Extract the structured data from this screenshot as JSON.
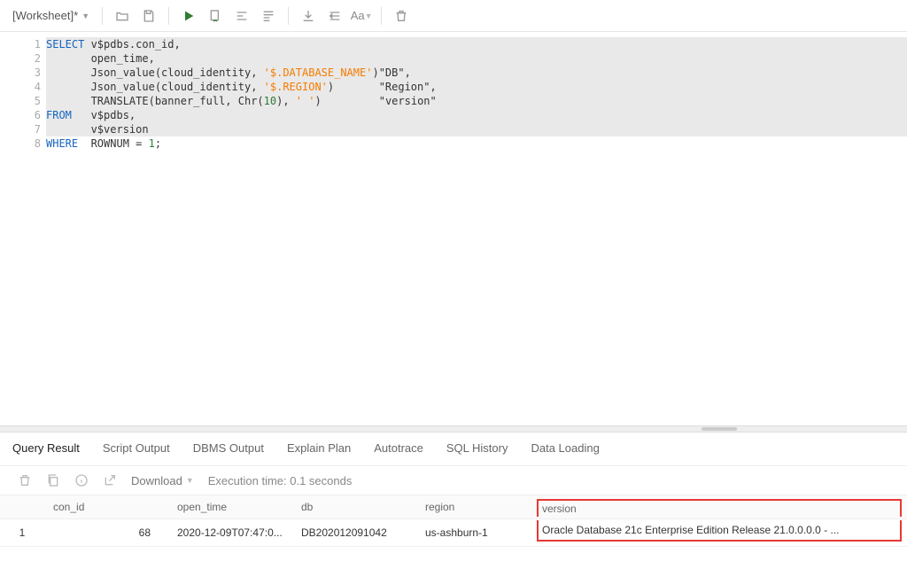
{
  "tab": {
    "label": "[Worksheet]*"
  },
  "toolbar": {
    "font_aa": "Aa"
  },
  "editor": {
    "line_numbers": [
      "1",
      "2",
      "3",
      "4",
      "5",
      "6",
      "7",
      "8"
    ],
    "lines": [
      {
        "hl": true,
        "tokens": [
          {
            "t": "SELECT",
            "c": "kw"
          },
          {
            "t": " v$pdbs.con_id,",
            "c": "id"
          }
        ]
      },
      {
        "hl": true,
        "tokens": [
          {
            "t": "       open_time,",
            "c": "id"
          }
        ]
      },
      {
        "hl": true,
        "tokens": [
          {
            "t": "       Json_value(cloud_identity, ",
            "c": "id"
          },
          {
            "t": "'$.DATABASE_NAME'",
            "c": "str"
          },
          {
            "t": ")\"DB\",",
            "c": "id"
          }
        ]
      },
      {
        "hl": true,
        "tokens": [
          {
            "t": "       Json_value(cloud_identity, ",
            "c": "id"
          },
          {
            "t": "'$.REGION'",
            "c": "str"
          },
          {
            "t": ")       \"Region\",",
            "c": "id"
          }
        ]
      },
      {
        "hl": true,
        "tokens": [
          {
            "t": "       TRANSLATE(banner_full, Chr(",
            "c": "id"
          },
          {
            "t": "10",
            "c": "num"
          },
          {
            "t": "), ",
            "c": "id"
          },
          {
            "t": "' '",
            "c": "str"
          },
          {
            "t": ")         \"version\"",
            "c": "id"
          }
        ]
      },
      {
        "hl": true,
        "tokens": [
          {
            "t": "FROM",
            "c": "kw"
          },
          {
            "t": "   v$pdbs,",
            "c": "id"
          }
        ]
      },
      {
        "hl": true,
        "tokens": [
          {
            "t": "       v$version",
            "c": "id"
          }
        ]
      },
      {
        "hl": false,
        "tokens": [
          {
            "t": "WHERE",
            "c": "kw"
          },
          {
            "t": "  ROWNUM = ",
            "c": "id"
          },
          {
            "t": "1",
            "c": "num"
          },
          {
            "t": ";",
            "c": "id"
          }
        ]
      }
    ]
  },
  "results": {
    "tabs": [
      "Query Result",
      "Script Output",
      "DBMS Output",
      "Explain Plan",
      "Autotrace",
      "SQL History",
      "Data Loading"
    ],
    "active_tab": 0,
    "download_label": "Download",
    "exec_time": "Execution time: 0.1 seconds",
    "columns": [
      "",
      "con_id",
      "open_time",
      "db",
      "region",
      "version"
    ],
    "rows": [
      {
        "idx": "1",
        "con_id": "68",
        "open_time": "2020-12-09T07:47:0...",
        "db": "DB202012091042",
        "region": "us-ashburn-1",
        "version": "Oracle Database 21c Enterprise Edition Release 21.0.0.0.0 - ..."
      }
    ]
  }
}
